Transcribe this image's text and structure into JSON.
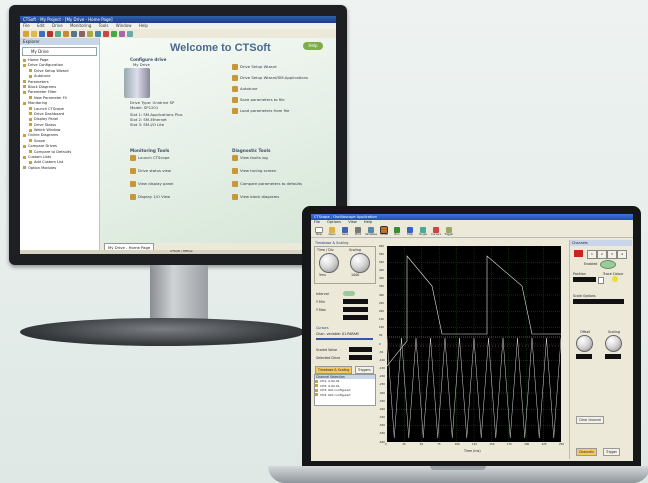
{
  "monitor": {
    "window_title": "CTSoft - My Project - [My Drive - Home Page]",
    "menu": [
      "File",
      "Edit",
      "Drive",
      "Monitoring",
      "Tools",
      "Window",
      "Help"
    ],
    "workspace": {
      "title": "Explorer",
      "dropdown": "My Drive",
      "tree": [
        "Home Page",
        "Drive Configuration",
        "Drive Setup Wizard",
        "Autotune",
        "Parameters",
        "Block Diagrams",
        "Parameter Filter",
        "New Parameter Fil",
        "Monitoring",
        "Launch CTScope",
        "Drive Dashboard",
        "Display Panel",
        "Drive Status",
        "Watch Window",
        "Online Diagrams",
        "Scope",
        "Compare Drives",
        "Compare to Defaults",
        "Custom Lists",
        "Add Custom List",
        "Option Modules"
      ]
    },
    "welcome_title": "Welcome to CTSoft",
    "help_label": "Help",
    "configure": {
      "heading": "Configure drive",
      "drive_name": "My Drive",
      "drive_type": "Drive Type: Unidrive SP",
      "model": "Model: SP1201",
      "slot1": "Slot 1: SM-Applications Plus",
      "slot2": "Slot 2: SM-Ethernet",
      "slot3": "Slot 3: SM-I/O Lite"
    },
    "tasks": [
      "Drive Setup Wizard",
      "Drive Setup Wizard/SM-Applications",
      "Autotune",
      "Save parameters to file",
      "Load parameters from file"
    ],
    "monitoring_heading": "Monitoring Tools",
    "monitoring_links": [
      "Launch CTScope",
      "Drive status view",
      "View display panel",
      "Display 1/O View"
    ],
    "diagnostic_heading": "Diagnostic Tools",
    "diagnostic_links": [
      "View faults log",
      "View tuning screen",
      "Compare parameters to defaults",
      "View block diagrams"
    ],
    "tab_label": "My Drive - Home Page",
    "status_text": "CTSoft / Offline"
  },
  "laptop": {
    "window_title": "CTScope - Oscilloscope Application",
    "menu": [
      "File",
      "Options",
      "View",
      "Help"
    ],
    "toolbar": [
      "New",
      "Open",
      "Save",
      "Print",
      "Variables",
      "Scope",
      "Run",
      "Stop",
      "Single",
      "Cursors",
      "Trigger"
    ],
    "timebase_group": "Timebase & Scaling",
    "time_div_label": "Time / Div",
    "scaling_label": "Scaling",
    "time_value": "5ms",
    "scaling_value": "1000",
    "interval_label": "Interval",
    "readouts": [
      "Y Min",
      "Y Max"
    ],
    "cursor_label": "Cursors",
    "channel_label": "Chan. variable: 01.PARAM",
    "channel_vals": [
      "Scaled Value",
      "Selected Drive"
    ],
    "tabs": [
      "Timebase & Scaling",
      "Triggers"
    ],
    "channels_title": "Channel Selection",
    "channels": [
      "CH1: 0.02.01",
      "CH2: 0.02.01",
      "CH3: Not configured",
      "CH4: Not configured"
    ],
    "plot": {
      "y_ticks": [
        "600",
        "550",
        "500",
        "450",
        "400",
        "350",
        "300",
        "250",
        "200",
        "150",
        "100",
        "50",
        "0",
        "-50",
        "-100",
        "-150",
        "-200",
        "-250",
        "-300",
        "-350",
        "-400",
        "-450",
        "-500",
        "-550",
        "-600"
      ],
      "x_ticks": [
        "0",
        "25",
        "50",
        "75",
        "100",
        "125",
        "150",
        "175",
        "200",
        "225",
        "250"
      ],
      "x_label": "Time (ms)"
    },
    "right": {
      "title": "Channels",
      "enabled_label": "Enabled",
      "position_label": "Position",
      "trace_color_label": "Trace Colour",
      "scale_label": "Scale Options",
      "offset_label": "Offset",
      "scaling_label": "Scaling",
      "clear_label": "Clear channel",
      "tabs": [
        "Channels",
        "Trigger"
      ],
      "buttons": [
        "1",
        "2",
        "3",
        "4"
      ]
    }
  }
}
